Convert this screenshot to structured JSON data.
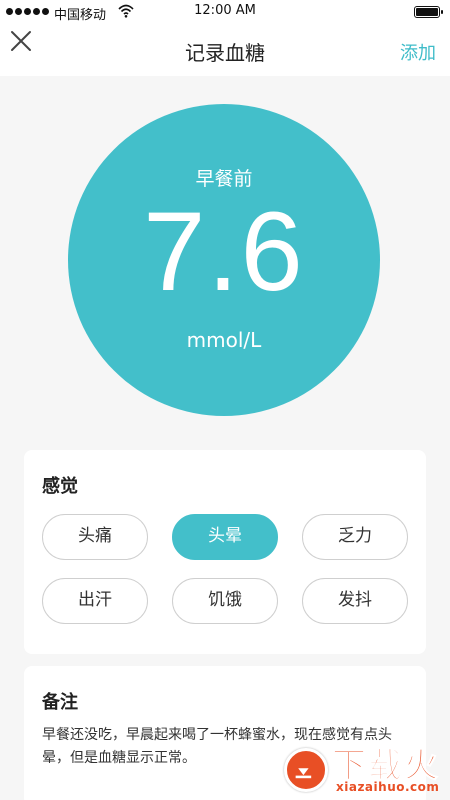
{
  "status_bar": {
    "carrier": "中国移动",
    "time": "12:00 AM"
  },
  "nav": {
    "title": "记录血糖",
    "add_label": "添加",
    "close_icon": "close-icon"
  },
  "reading": {
    "meal": "早餐前",
    "value": "7.6",
    "unit": "mmol/L",
    "color": "#43bfca"
  },
  "feelings": {
    "title": "感觉",
    "options": [
      {
        "label": "头痛",
        "selected": false
      },
      {
        "label": "头晕",
        "selected": true
      },
      {
        "label": "乏力",
        "selected": false
      },
      {
        "label": "出汗",
        "selected": false
      },
      {
        "label": "饥饿",
        "selected": false
      },
      {
        "label": "发抖",
        "selected": false
      }
    ]
  },
  "notes": {
    "title": "备注",
    "text": "早餐还没吃，早晨起来喝了一杯蜂蜜水，现在感觉有点头晕，但是血糖显示正常。"
  },
  "watermark": {
    "text": "下载火",
    "url": "xiazaihuo.com"
  },
  "colors": {
    "accent": "#43bfca",
    "watermark": "#e84f25"
  }
}
